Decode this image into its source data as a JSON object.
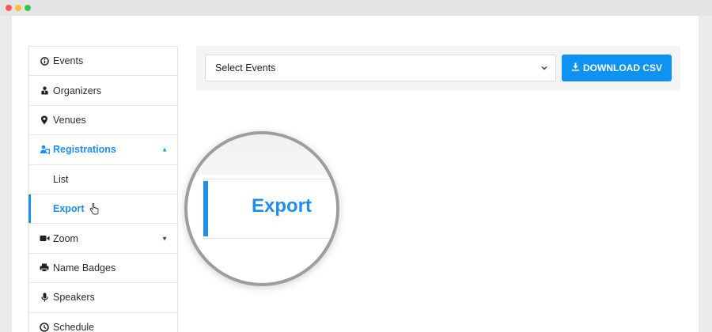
{
  "sidebar": {
    "items": [
      {
        "label": "Events",
        "icon": "info-circle-icon"
      },
      {
        "label": "Organizers",
        "icon": "user-tie-icon"
      },
      {
        "label": "Venues",
        "icon": "map-pin-icon"
      },
      {
        "label": "Registrations",
        "icon": "user-group-icon"
      },
      {
        "label": "List"
      },
      {
        "label": "Export"
      },
      {
        "label": "Zoom",
        "icon": "video-camera-icon"
      },
      {
        "label": "Name Badges",
        "icon": "printer-icon"
      },
      {
        "label": "Speakers",
        "icon": "microphone-icon"
      },
      {
        "label": "Schedule",
        "icon": "clock-icon"
      }
    ]
  },
  "toolbar": {
    "select_value": "Select Events",
    "download_label": "DOWNLOAD CSV"
  },
  "magnifier": {
    "label": "Export"
  },
  "colors": {
    "accent": "#1e8ff0",
    "button": "#0f93f3"
  }
}
